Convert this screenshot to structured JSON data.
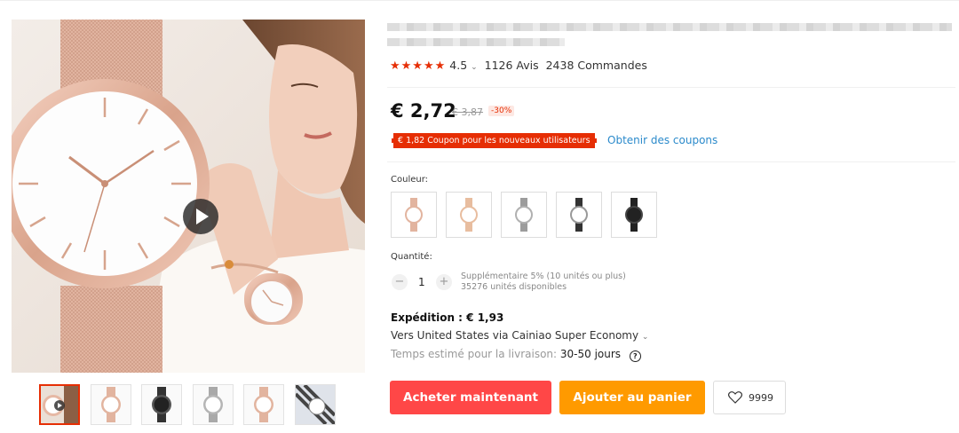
{
  "product": {
    "rating_value": "4.5",
    "rating_chevron": "⌄",
    "reviews": "1126 Avis",
    "orders": "2438 Commandes",
    "price": "€ 2,72",
    "old_price": "€ 3,87",
    "discount": "-30%",
    "coupon_text": "€ 1,82 Coupon pour les nouveaux utilisateurs",
    "coupon_link": "Obtenir des coupons",
    "color_label": "Couleur:",
    "quantity_label": "Quantité:",
    "quantity_value": "1",
    "quantity_minus": "−",
    "quantity_plus": "+",
    "bulk_note": "Supplémentaire 5% (10 unités ou plus)",
    "stock_note": "35276 unités disponibles",
    "shipping_title": "Expédition : € 1,93",
    "shipping_to": "Vers United States via Cainiao Super Economy",
    "shipping_chevron": "⌄",
    "eta_label": "Temps estimé pour la livraison:",
    "eta_value": "30-50 jours",
    "help_icon": "?",
    "buy_now": "Acheter maintenant",
    "add_to_cart": "Ajouter au panier",
    "wishlist_count": "9999"
  },
  "colors": {
    "accent_red": "#e62e04",
    "buy_button": "#ff4747",
    "cart_button": "#ff9a00",
    "link_blue": "#2b8acb"
  },
  "icons": [
    "star-icon",
    "play-icon",
    "heart-icon",
    "help-icon",
    "chevron-down-icon"
  ]
}
